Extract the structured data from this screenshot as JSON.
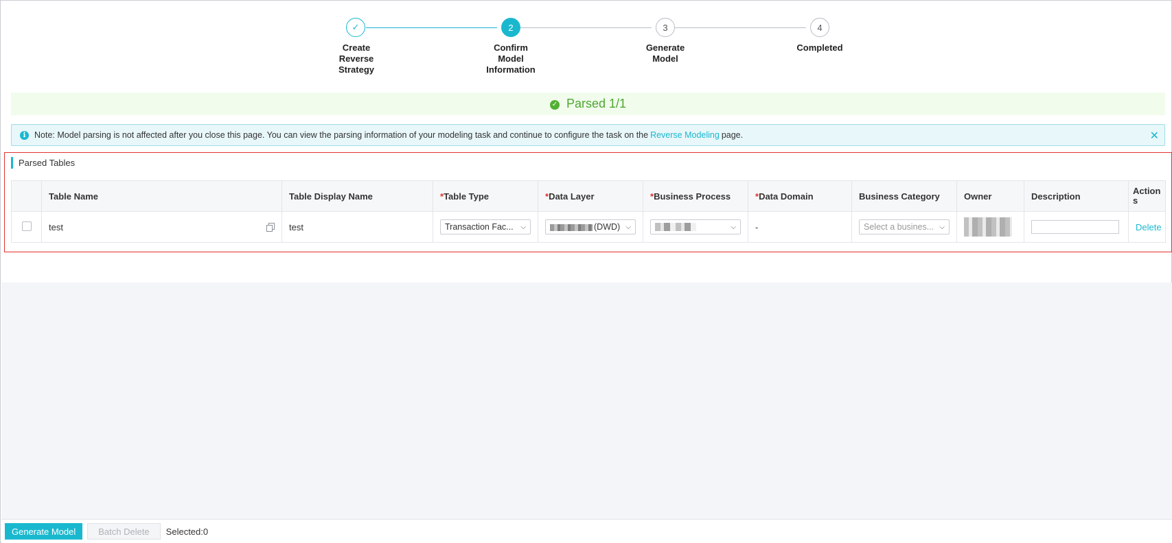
{
  "steps": [
    {
      "number": "✓",
      "label": "Create Reverse Strategy",
      "state": "done"
    },
    {
      "number": "2",
      "label": "Confirm Model Information",
      "state": "active"
    },
    {
      "number": "3",
      "label": "Generate Model",
      "state": "pending"
    },
    {
      "number": "4",
      "label": "Completed",
      "state": "pending"
    }
  ],
  "banner": {
    "text": "Parsed 1/1",
    "icon": "check-circle-icon"
  },
  "note": {
    "before": "Note: Model parsing is not affected after you close this page. You can view the parsing information of your modeling task and continue to configure the task on the",
    "link": "Reverse Modeling",
    "after": "page.",
    "close": "✕"
  },
  "section_title": "Parsed Tables",
  "table": {
    "headers": {
      "table_name": "Table Name",
      "display_name": "Table Display Name",
      "table_type": "Table Type",
      "data_layer": "Data Layer",
      "business_process": "Business Process",
      "data_domain": "Data Domain",
      "business_category": "Business Category",
      "owner": "Owner",
      "description": "Description",
      "actions": "Actions"
    },
    "required_mark": "*",
    "rows": [
      {
        "table_name": "test",
        "display_name": "test",
        "table_type": "Transaction Fac...",
        "data_layer_suffix": "(DWD)",
        "data_domain": "-",
        "business_category_placeholder": "Select a busines...",
        "action": "Delete"
      }
    ]
  },
  "footer": {
    "generate": "Generate Model",
    "batch_delete": "Batch Delete",
    "selected": "Selected:0"
  },
  "colors": {
    "accent": "#1ab8cf",
    "success": "#52b034",
    "required": "#e0312d"
  }
}
